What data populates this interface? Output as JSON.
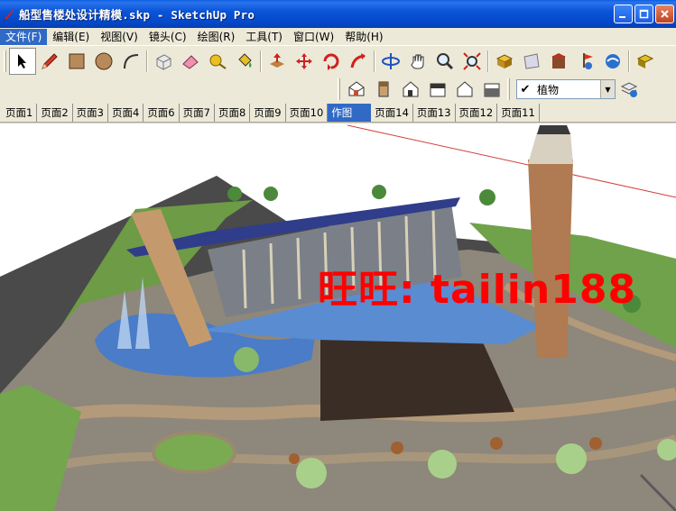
{
  "window": {
    "title": "船型售楼处设计精模.skp - SketchUp Pro",
    "minimize_icon": "minimize-icon",
    "maximize_icon": "maximize-icon",
    "close_icon": "close-icon"
  },
  "menu": {
    "items": [
      {
        "label": "文件(F)"
      },
      {
        "label": "编辑(E)"
      },
      {
        "label": "视图(V)"
      },
      {
        "label": "镜头(C)"
      },
      {
        "label": "绘图(R)"
      },
      {
        "label": "工具(T)"
      },
      {
        "label": "窗口(W)"
      },
      {
        "label": "帮助(H)"
      }
    ]
  },
  "toolbar": {
    "main_tools": [
      "select-icon",
      "pencil-icon",
      "rectangle-icon",
      "circle-icon",
      "arc-icon",
      "make-component-icon",
      "eraser-icon",
      "tape-measure-icon",
      "paint-bucket-icon",
      "push-pull-icon",
      "move-icon",
      "rotate-icon",
      "follow-me-icon",
      "orbit-icon",
      "pan-icon",
      "zoom-icon",
      "zoom-extents-icon",
      "get-models-icon",
      "share-model-icon",
      "component-warehouse-icon",
      "add-location-icon",
      "google-earth-icon",
      "preview-icon"
    ],
    "view_tools": [
      "iso-view-icon",
      "top-view-icon",
      "front-view-icon",
      "right-view-icon",
      "back-view-icon",
      "left-view-icon"
    ],
    "layer": {
      "current": "植物",
      "layer_manager_icon": "layer-manager-icon"
    }
  },
  "scenes": {
    "tabs": [
      {
        "label": "页面1"
      },
      {
        "label": "页面2"
      },
      {
        "label": "页面3"
      },
      {
        "label": "页面4"
      },
      {
        "label": "页面6"
      },
      {
        "label": "页面7"
      },
      {
        "label": "页面8"
      },
      {
        "label": "页面9"
      },
      {
        "label": "页面10"
      },
      {
        "label": "作图",
        "active": true
      },
      {
        "label": "页面14"
      },
      {
        "label": "页面13"
      },
      {
        "label": "页面12"
      },
      {
        "label": "页面11"
      }
    ]
  },
  "viewport": {
    "watermark": "旺旺: tailin188",
    "colors": {
      "watermark": "#ff0000",
      "ground_paving": "#8f877a",
      "grass": "#6fa24a",
      "water": "#4a7cc7",
      "roof": "#2f3d8a"
    }
  }
}
